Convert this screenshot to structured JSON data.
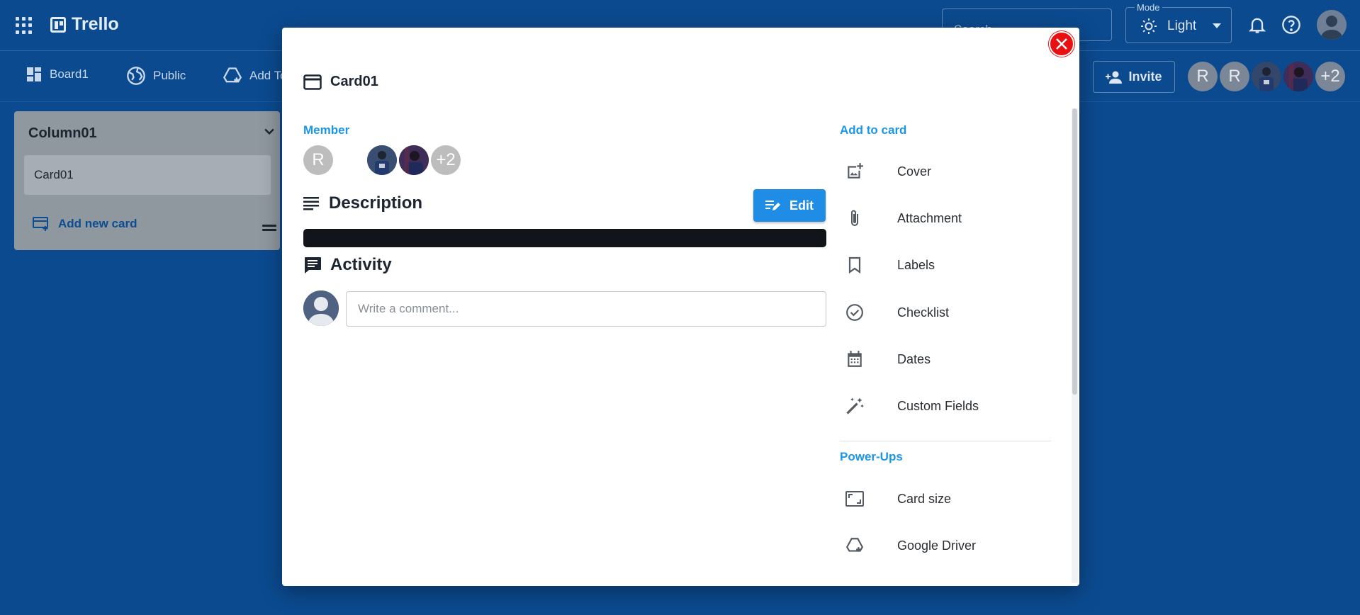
{
  "app": {
    "name": "Trello",
    "search_placeholder": "Search",
    "mode_label": "Mode",
    "mode_value": "Light"
  },
  "board": {
    "name": "Board1",
    "visibility": "Public",
    "add_to_label": "Add To",
    "invite_label": "Invite",
    "member_initials": [
      "R",
      "R"
    ],
    "members_extra": "+2"
  },
  "column": {
    "title": "Column01",
    "cards": [
      "Card01"
    ],
    "add_card_label": "Add new card"
  },
  "modal": {
    "card_title": "Card01",
    "member_label": "Member",
    "member_initial": "R",
    "members_extra": "+2",
    "description_label": "Description",
    "edit_label": "Edit",
    "activity_label": "Activity",
    "comment_placeholder": "Write a comment...",
    "add_to_card_label": "Add to card",
    "add_to_card_items": [
      "Cover",
      "Attachment",
      "Labels",
      "Checklist",
      "Dates",
      "Custom Fields"
    ],
    "powerups_label": "Power-Ups",
    "powerups_items": [
      "Card size",
      "Google Driver"
    ]
  },
  "colors": {
    "background": "#0b4a8f",
    "accent": "#1b96e8",
    "edit_button": "#1f8de6",
    "close_button": "#e81010"
  }
}
